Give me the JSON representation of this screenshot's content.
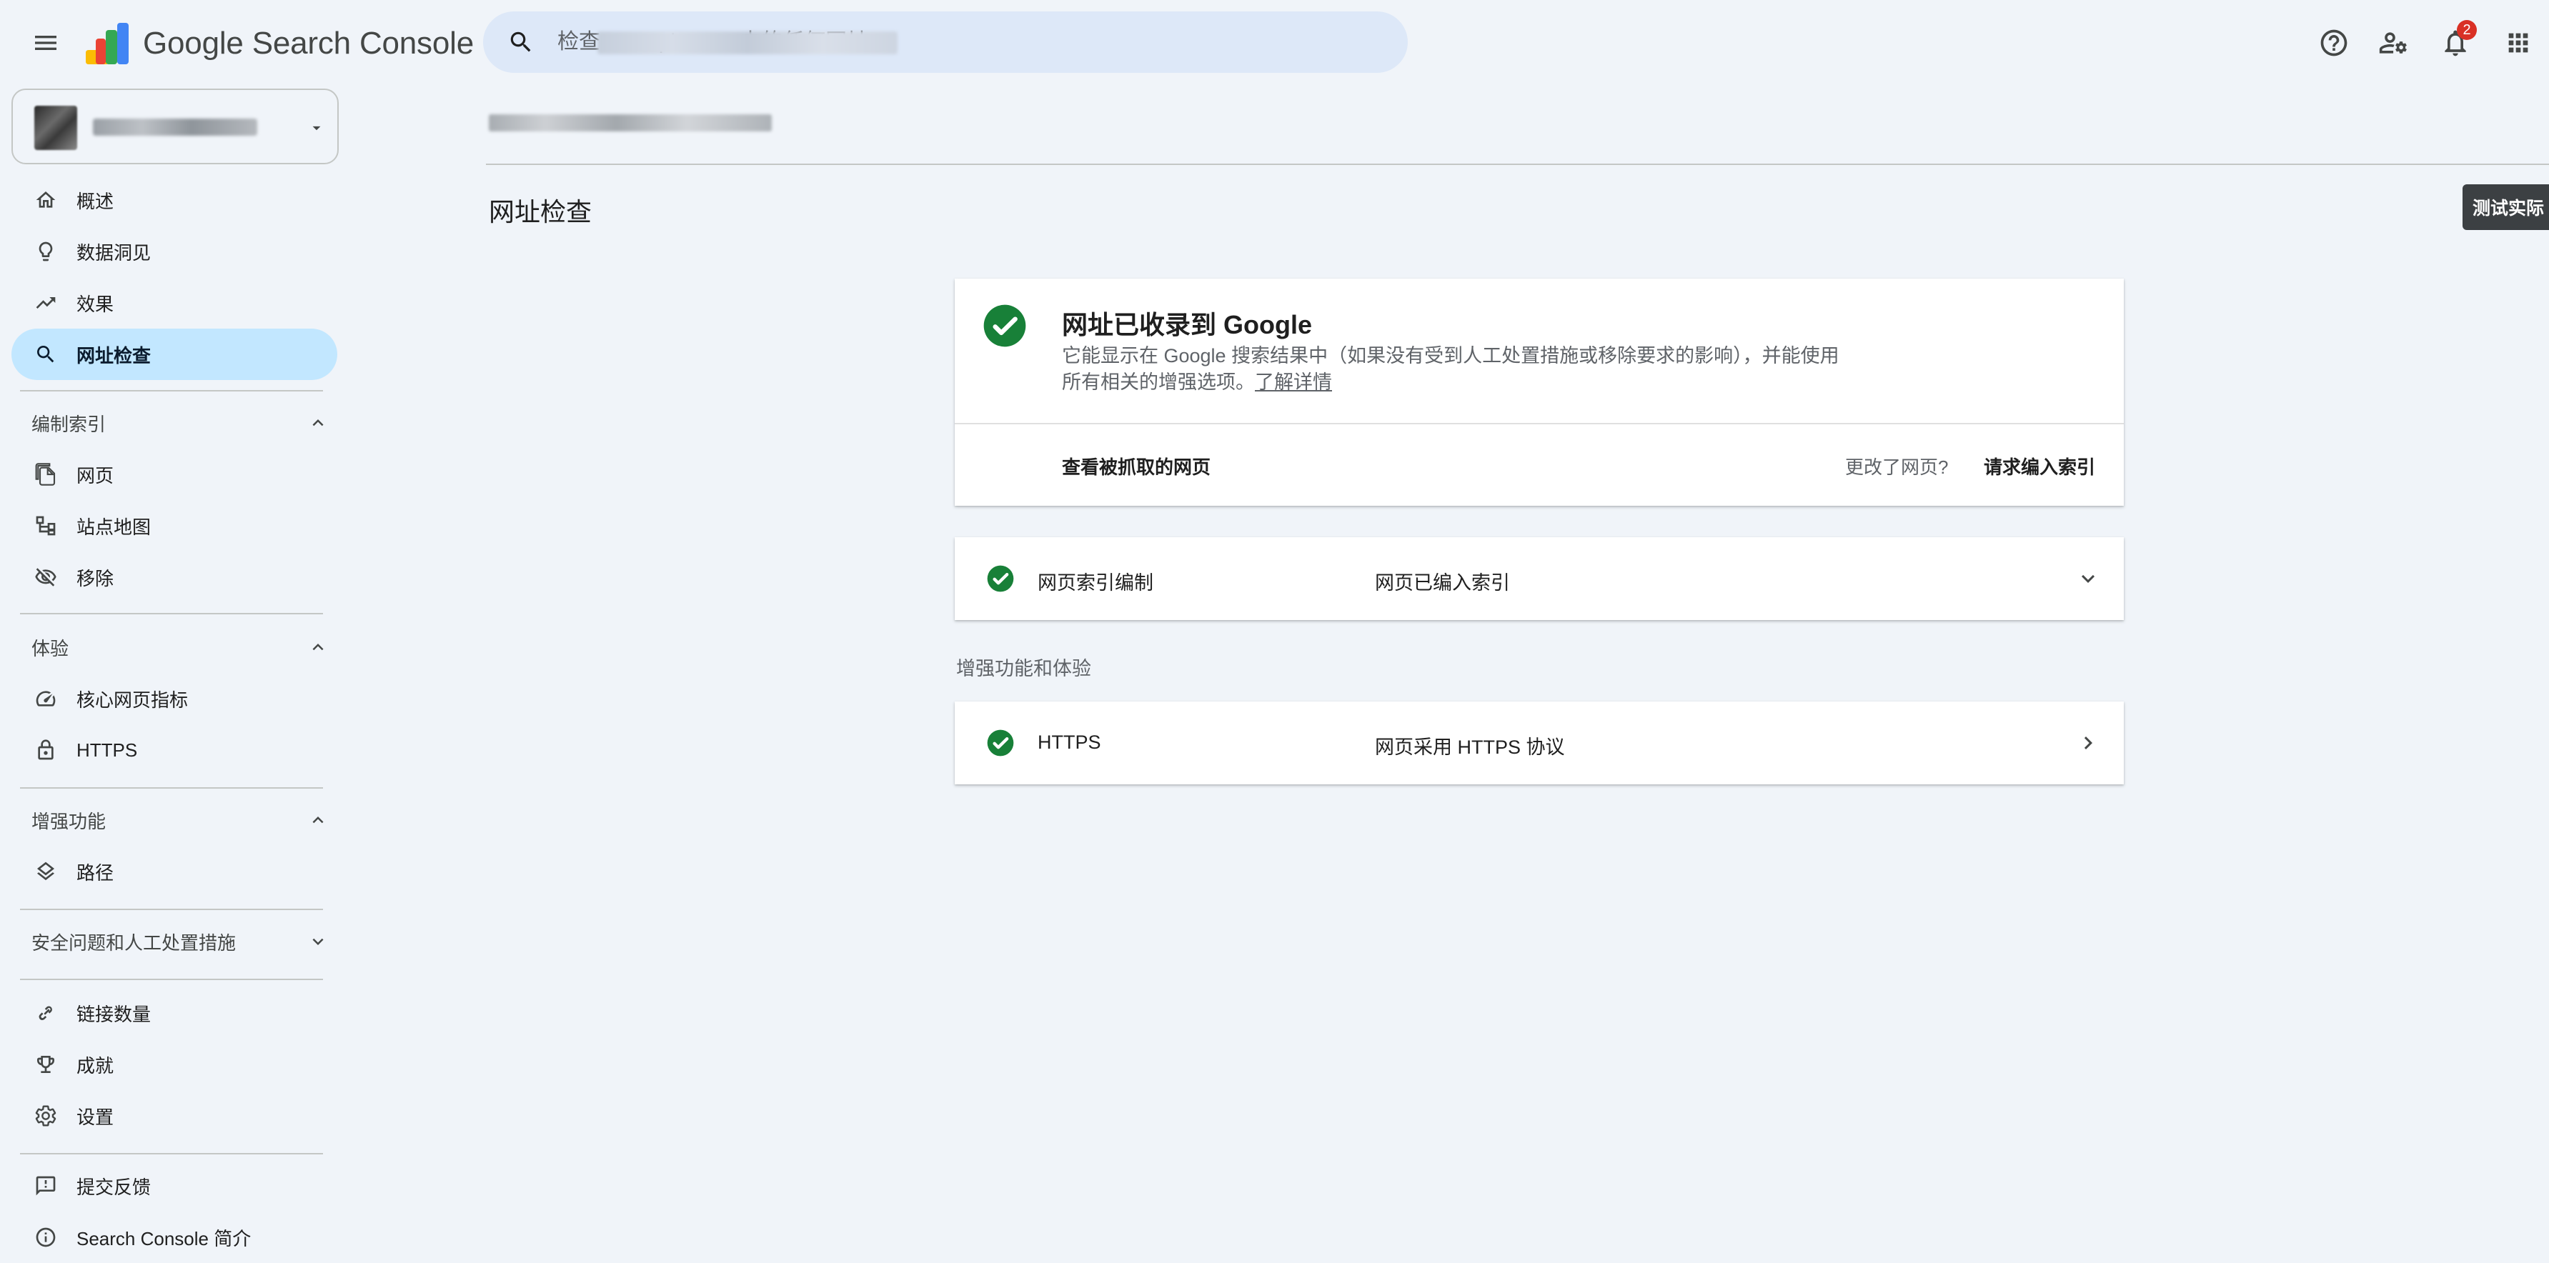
{
  "header": {
    "product_name": "Google Search Console",
    "search_placeholder": "检查 example.com 中的任何网址",
    "search_value_visible": "中的任何网址",
    "search_prefix_visible": "检",
    "notification_count": "2",
    "icons": [
      "menu-icon",
      "search-icon",
      "help-icon",
      "manage-users-icon",
      "notifications-icon",
      "apps-icon"
    ]
  },
  "sidebar": {
    "items": [
      {
        "label": "概述",
        "icon": "home-icon"
      },
      {
        "label": "数据洞见",
        "icon": "lightbulb-icon"
      },
      {
        "label": "效果",
        "icon": "trending-up-icon"
      },
      {
        "label": "网址检查",
        "icon": "search-icon",
        "active": true
      }
    ],
    "sections": [
      {
        "title": "编制索引",
        "expanded": true,
        "items": [
          {
            "label": "网页",
            "icon": "pages-icon"
          },
          {
            "label": "站点地图",
            "icon": "sitemap-icon"
          },
          {
            "label": "移除",
            "icon": "visibility-off-icon"
          }
        ]
      },
      {
        "title": "体验",
        "expanded": true,
        "items": [
          {
            "label": "核心网页指标",
            "icon": "speed-icon"
          },
          {
            "label": "HTTPS",
            "icon": "lock-icon"
          }
        ]
      },
      {
        "title": "增强功能",
        "expanded": true,
        "items": [
          {
            "label": "路径",
            "icon": "layers-icon"
          }
        ]
      },
      {
        "title": "安全问题和人工处置措施",
        "expanded": false,
        "items": []
      }
    ],
    "bottom_items": [
      {
        "label": "链接数量",
        "icon": "link-icon"
      },
      {
        "label": "成就",
        "icon": "trophy-icon"
      },
      {
        "label": "设置",
        "icon": "settings-icon"
      }
    ],
    "footer_items": [
      {
        "label": "提交反馈",
        "icon": "feedback-icon"
      },
      {
        "label": "Search Console 简介",
        "icon": "info-icon"
      }
    ]
  },
  "main": {
    "page_title": "网址检查",
    "live_test_label": "测试实际",
    "status_card": {
      "title": "网址已收录到 Google",
      "description": "它能显示在 Google 搜索结果中（如果没有受到人工处置措施或移除要求的影响），并能使用所有相关的增强选项。",
      "learn_more": "了解详情",
      "view_crawled": "查看被抓取的网页",
      "changed_prompt": "更改了网页?",
      "request_indexing": "请求编入索引"
    },
    "indexing_row": {
      "name": "网页索引编制",
      "value": "网页已编入索引"
    },
    "enhancements_caption": "增强功能和体验",
    "https_row": {
      "name": "HTTPS",
      "value": "网页采用 HTTPS 协议"
    }
  },
  "colors": {
    "background": "#f0f4f9",
    "search_bg": "#dde8f8",
    "active_nav": "#c2e7ff",
    "success_green": "#188038",
    "badge_red": "#d93025",
    "tooltip_button": "#3c4043"
  }
}
